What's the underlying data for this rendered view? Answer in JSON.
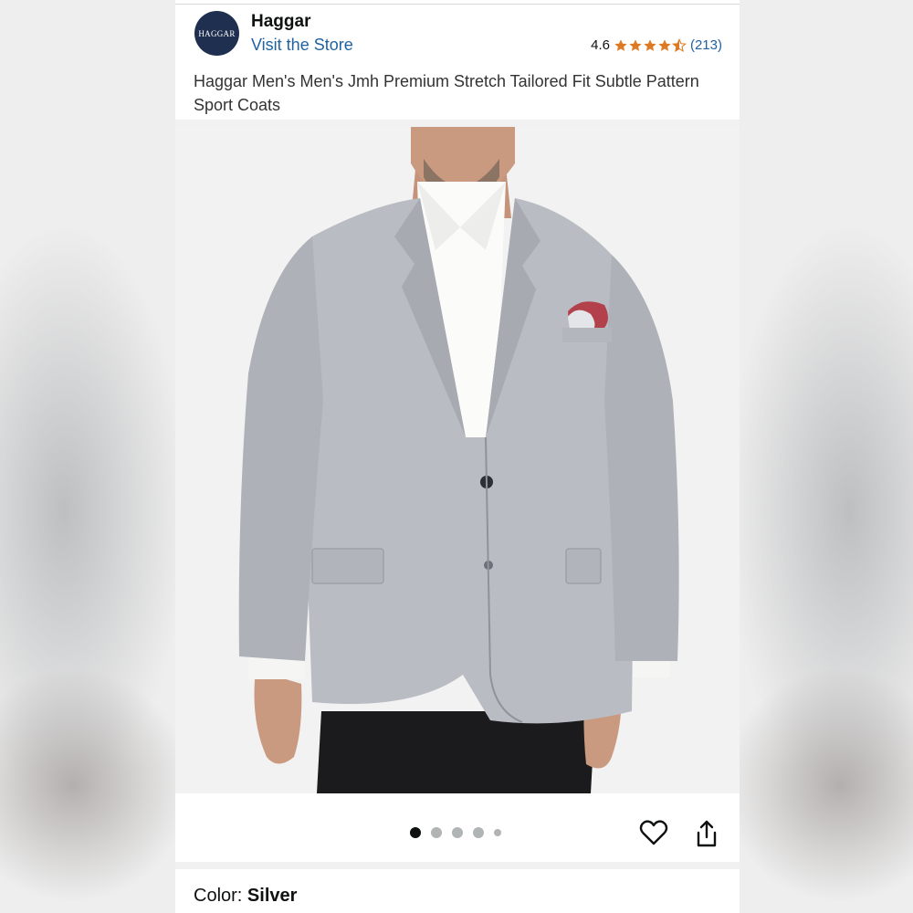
{
  "store": {
    "logo_text": "HAGGAR",
    "name": "Haggar",
    "visit_label": "Visit the Store"
  },
  "rating": {
    "value": "4.6",
    "stars": 4.5,
    "count_label": "(213)"
  },
  "product": {
    "title": "Haggar Men's Men's Jmh Premium Stretch Tailored Fit Subtle Pattern Sport Coats"
  },
  "gallery": {
    "image_count": 5,
    "active_index": 0
  },
  "variant": {
    "color_label": "Color:",
    "color_value": "Silver"
  },
  "colors": {
    "link": "#2162a1",
    "star": "#de7921",
    "brand_logo_bg": "#1f2f4f"
  },
  "icons": [
    "heart-icon",
    "share-icon",
    "star-icon"
  ]
}
